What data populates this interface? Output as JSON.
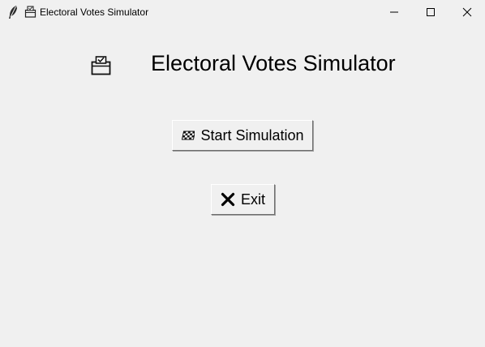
{
  "window": {
    "title": "Electoral Votes Simulator",
    "controls": {
      "minimize": "minimize-icon",
      "maximize": "maximize-icon",
      "close": "close-icon"
    }
  },
  "main": {
    "header_icon": "ballot-box-icon",
    "title": "Electoral Votes Simulator",
    "buttons": {
      "start": {
        "icon": "checkered-flag-icon",
        "label": "Start Simulation"
      },
      "exit": {
        "icon": "x-mark-icon",
        "label": "Exit"
      }
    }
  }
}
